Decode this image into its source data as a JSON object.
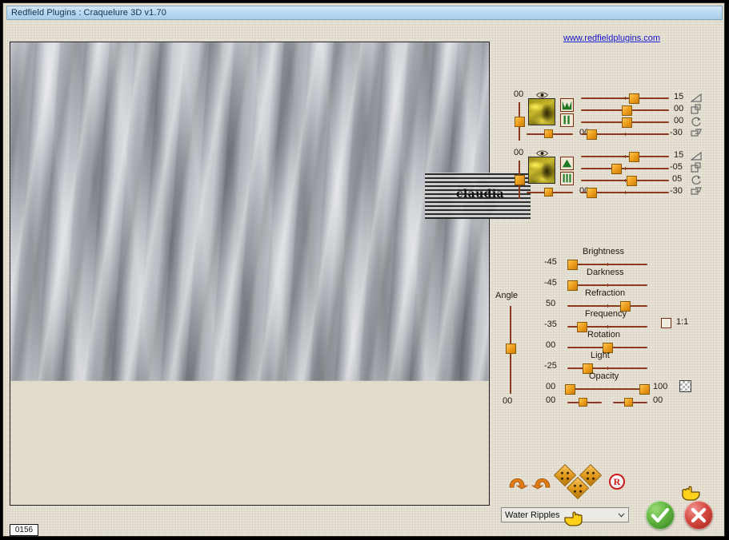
{
  "window": {
    "title": "Redfield Plugins : Craquelure 3D  v1.70",
    "status_value": "0156",
    "link": "www.redfieldplugins.com"
  },
  "preview": {
    "name": "preview-canvas",
    "watermark_text": "claudia"
  },
  "texture_blocks": [
    {
      "name": "layer-1",
      "depth_value": "00",
      "eye_icon": "eye-icon",
      "thumb_icon": "texture-thumbnail",
      "profile_icon": "valley-profile-icon",
      "pattern_icon": "two-bars-icon",
      "bottom_value": "00",
      "bottom_knob_pct": 40,
      "vertical_knob_pct": 52,
      "rows": [
        {
          "label": "bevel",
          "value": "15",
          "icon": "triangle-bevel-icon",
          "knob_pct": 61
        },
        {
          "label": "size",
          "value": "00",
          "icon": "scale-icon",
          "knob_pct": 43
        },
        {
          "label": "rotation",
          "value": "00",
          "icon": "rotate-icon",
          "knob_pct": 43
        },
        {
          "label": "shear",
          "value": "-30",
          "icon": "shear-icon",
          "knob_pct": 19
        }
      ]
    },
    {
      "name": "layer-2",
      "depth_value": "00",
      "eye_icon": "eye-icon",
      "thumb_icon": "texture-thumbnail",
      "profile_icon": "mountain-profile-icon",
      "pattern_icon": "three-bars-icon",
      "bottom_value": "00",
      "bottom_knob_pct": 40,
      "vertical_knob_pct": 52,
      "rows": [
        {
          "label": "bevel",
          "value": "15",
          "icon": "triangle-bevel-icon",
          "knob_pct": 61
        },
        {
          "label": "size",
          "value": "-05",
          "icon": "scale-icon",
          "knob_pct": 35
        },
        {
          "label": "rotation",
          "value": "05",
          "icon": "rotate-icon",
          "knob_pct": 47
        },
        {
          "label": "shear",
          "value": "-30",
          "icon": "shear-icon",
          "knob_pct": 19
        }
      ]
    }
  ],
  "angle": {
    "label": "Angle",
    "value": "00",
    "knob_pct": 52
  },
  "main_sliders": [
    {
      "label": "Brightness",
      "value": "-45",
      "knob_pct": 5
    },
    {
      "label": "Darkness",
      "value": "-45",
      "knob_pct": 5
    },
    {
      "label": "Refraction",
      "value": "50",
      "knob_pct": 73
    },
    {
      "label": "Frequency",
      "value": "-35",
      "knob_pct": 15
    },
    {
      "label": "Rotation",
      "value": "00",
      "knob_pct": 50
    },
    {
      "label": "Light",
      "value": "-25",
      "knob_pct": 24
    }
  ],
  "opacity": {
    "label": "Opacity",
    "left_value": "00",
    "right_value": "100",
    "left_knob_pct": 2,
    "right_knob_pct": 96,
    "checker_icon": "transparency-checker-icon"
  },
  "extra_row": {
    "left_value": "00",
    "right_value": "00",
    "left_knob_pct": 40,
    "right_knob_pct": 40
  },
  "ratio": {
    "label": "1:1",
    "checked": false
  },
  "toolbar": {
    "undo_icon": "undo-arrow-icon",
    "redo_icon": "redo-arrow-icon",
    "preset_icons": [
      "preset-diamond-1",
      "preset-diamond-2",
      "preset-diamond-3"
    ],
    "register_badge": "R",
    "preset_name": "Water Ripples",
    "ok_icon": "checkmark-icon",
    "cancel_icon": "cross-icon",
    "cursor_icon": "pointing-hand-cursor"
  }
}
